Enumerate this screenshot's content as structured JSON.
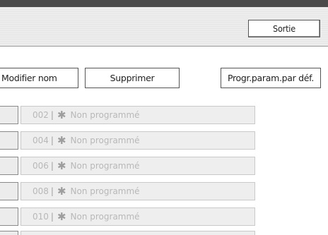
{
  "header": {
    "exit_label": "Sortie"
  },
  "toolbar": {
    "modify_label": "Modifier nom",
    "delete_label": "Supprimer",
    "default_label": "Progr.param.par déf."
  },
  "programs": [
    {
      "number": "002",
      "separator": "|",
      "star": "✱",
      "status": "Non programmé"
    },
    {
      "number": "004",
      "separator": "|",
      "star": "✱",
      "status": "Non programmé"
    },
    {
      "number": "006",
      "separator": "|",
      "star": "✱",
      "status": "Non programmé"
    },
    {
      "number": "008",
      "separator": "|",
      "star": "✱",
      "status": "Non programmé"
    },
    {
      "number": "010",
      "separator": "|",
      "star": "✱",
      "status": "Non programmé"
    }
  ]
}
